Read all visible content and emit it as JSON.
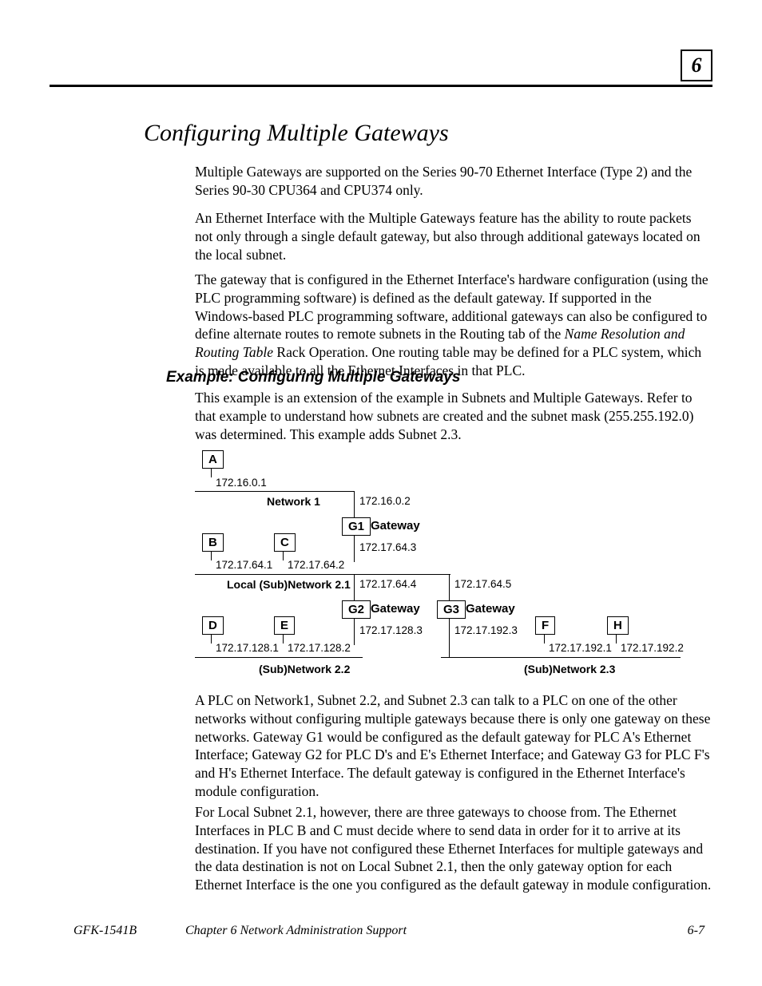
{
  "chapterNumber": "6",
  "sectionTitle": "Configuring Multiple Gateways",
  "para1": "Multiple Gateways are supported on the Series 90-70 Ethernet Interface (Type 2) and the Series 90-30 CPU364 and CPU374 only.",
  "para2": "An Ethernet Interface with the Multiple Gateways feature has the ability to route packets not only through a single default gateway, but also through additional gateways located on the local subnet.",
  "para3a": "The gateway that is configured in the Ethernet Interface's hardware configuration (using the PLC programming software) is defined as the default gateway.  If supported in the Windows-based PLC programming software, additional gateways can also be configured to define alternate routes to remote subnets in the Routing tab of the ",
  "para3ital": "Name Resolution and Routing Table",
  "para3b": " Rack Operation. One routing table may be defined for a PLC system, which is made available to all the Ethernet Interfaces in that PLC.",
  "subheading": "Example:  Configuring Multiple Gateways",
  "para4": "This example is an extension of the example in Subnets and Multiple Gateways.  Refer to that example to understand how subnets are created and the subnet mask (255.255.192.0) was determined. This example adds Subnet 2.3.",
  "para5": "A PLC on Network1, Subnet 2.2, and Subnet 2.3 can talk to a PLC on one of the other networks without configuring multiple gateways because there is only one gateway on these networks. Gateway G1 would be configured as the default gateway for PLC A's Ethernet Interface; Gateway G2 for PLC D's and E's Ethernet Interface; and Gateway G3 for PLC F's and H's Ethernet Interface.  The default gateway is configured in the Ethernet Interface's module configuration.",
  "para6": "For Local Subnet 2.1, however, there are three gateways to choose from.  The Ethernet Interfaces in  PLC B and C must decide where to send data in order for it to arrive at its destination.  If you have not configured these Ethernet Interfaces for multiple gateways and the data destination is not on Local Subnet 2.1, then the only gateway option for each Ethernet Interface is the one you configured as the default gateway in module configuration.",
  "diagram": {
    "boxA": "A",
    "ipA": "172.16.0.1",
    "net1": "Network 1",
    "ipG1top": "172.16.0.2",
    "boxG1": "G1",
    "gw1": "Gateway",
    "boxB": "B",
    "boxC": "C",
    "ipB": "172.17.64.1",
    "ipC": "172.17.64.2",
    "ipG1bot": "172.17.64.3",
    "net21": "Local (Sub)Network 2.1",
    "ipG2top": "172.17.64.4",
    "ipG3top": "172.17.64.5",
    "boxG2": "G2",
    "gw2": "Gateway",
    "boxG3": "G3",
    "gw3": "Gateway",
    "boxD": "D",
    "boxE": "E",
    "ipD": "172.17.128.1",
    "ipE": "172.17.128.2",
    "ipG2bot": "172.17.128.3",
    "ipG3bot": "172.17.192.3",
    "boxF": "F",
    "boxH": "H",
    "ipF": "172.17.192.1",
    "ipH": "172.17.192.2",
    "net22": "(Sub)Network 2.2",
    "net23": "(Sub)Network 2.3"
  },
  "footer": {
    "left": "GFK-1541B",
    "mid": "Chapter 6  Network Administration Support",
    "right": "6-7"
  }
}
